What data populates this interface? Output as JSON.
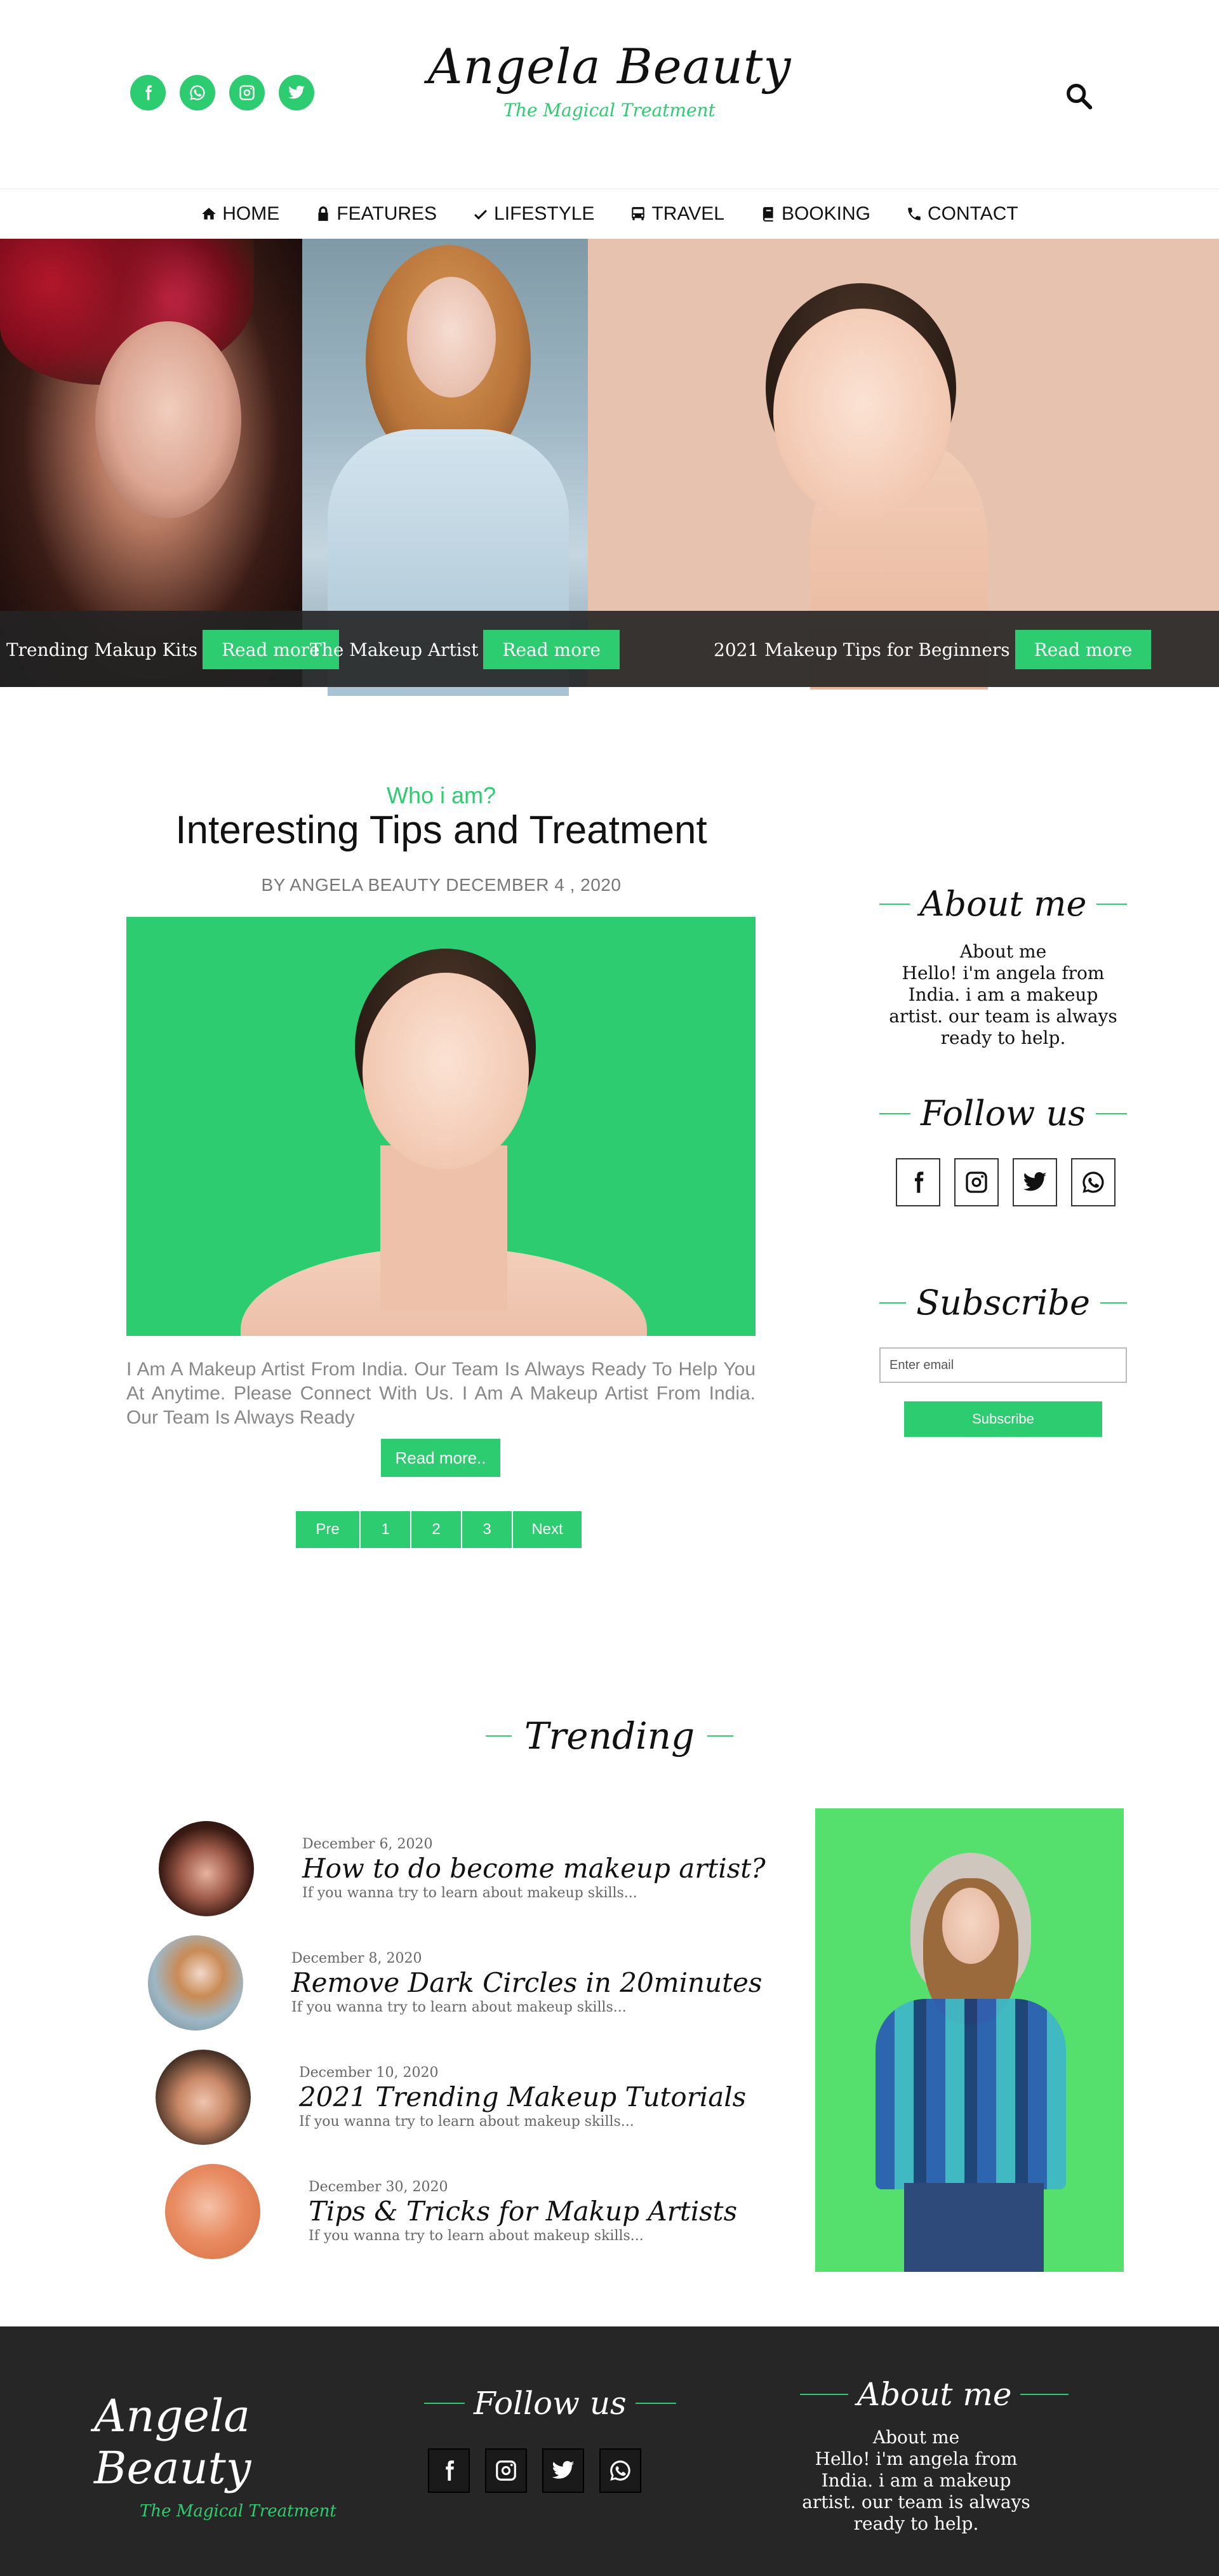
{
  "header": {
    "brand_title": "Angela Beauty",
    "brand_tagline": "The Magical Treatment",
    "social_icons": [
      "facebook-icon",
      "whatsapp-icon",
      "instagram-icon",
      "twitter-icon"
    ],
    "search_icon": "search-icon"
  },
  "nav": {
    "items": [
      {
        "label": "HOME",
        "icon": "home-icon"
      },
      {
        "label": "FEATURES",
        "icon": "lock-icon"
      },
      {
        "label": "LIFESTYLE",
        "icon": "check-icon"
      },
      {
        "label": "TRAVEL",
        "icon": "bus-icon"
      },
      {
        "label": "BOOKING",
        "icon": "book-icon"
      },
      {
        "label": "CONTACT",
        "icon": "phone-icon"
      }
    ]
  },
  "hero": {
    "slides": [
      {
        "caption": "Trending Makup Kits",
        "button": "Read more"
      },
      {
        "caption": "The Makeup Artist",
        "button": "Read more"
      },
      {
        "caption": "2021 Makeup Tips for Beginners",
        "button": "Read more"
      }
    ]
  },
  "post": {
    "kicker": "Who i am?",
    "title": "Interesting Tips and Treatment",
    "byline": "BY ANGELA BEAUTY DECEMBER 4 , 2020",
    "excerpt": "I Am A Makeup Artist From India. Our Team Is Always Ready To Help You At Anytime. Please Connect With Us. I Am A Makeup Artist From India. Our Team Is Always Ready",
    "read_more": "Read more.."
  },
  "pagination": {
    "prev": "Pre",
    "pages": [
      "1",
      "2",
      "3"
    ],
    "next": "Next"
  },
  "sidebar": {
    "about_heading": "About me",
    "about_title": "About me",
    "about_text": "Hello! i'm angela from India. i am a makeup artist. our team is always ready to help.",
    "follow_heading": "Follow us",
    "follow_icons": [
      "facebook-icon",
      "instagram-icon",
      "twitter-icon",
      "whatsapp-icon"
    ],
    "subscribe_heading": "Subscribe",
    "email_placeholder": "Enter email",
    "subscribe_button": "Subscribe"
  },
  "trending": {
    "heading": "Trending",
    "items": [
      {
        "date": "December 6, 2020",
        "title": "How to do become makeup artist?",
        "desc": "If you wanna try to learn about makeup skills..."
      },
      {
        "date": "December 8, 2020",
        "title": "Remove Dark Circles in 20minutes",
        "desc": "If you wanna try to learn about makeup skills..."
      },
      {
        "date": "December 10, 2020",
        "title": "2021 Trending Makeup Tutorials",
        "desc": "If you wanna try to learn about makeup skills..."
      },
      {
        "date": "December 30, 2020",
        "title": "Tips & Tricks for Makup Artists",
        "desc": "If you wanna try to learn about makeup skills..."
      }
    ]
  },
  "footer": {
    "brand_title": "Angela Beauty",
    "brand_tagline": "The Magical Treatment",
    "follow_heading": "Follow us",
    "about_heading": "About me",
    "about_title": "About me",
    "about_text": "Hello! i'm angela from India. i am a makeup artist. our team is always ready to help."
  },
  "colors": {
    "accent": "#2ecc71",
    "footer_bg": "#262626",
    "hero_caption_bg": "#232323"
  }
}
